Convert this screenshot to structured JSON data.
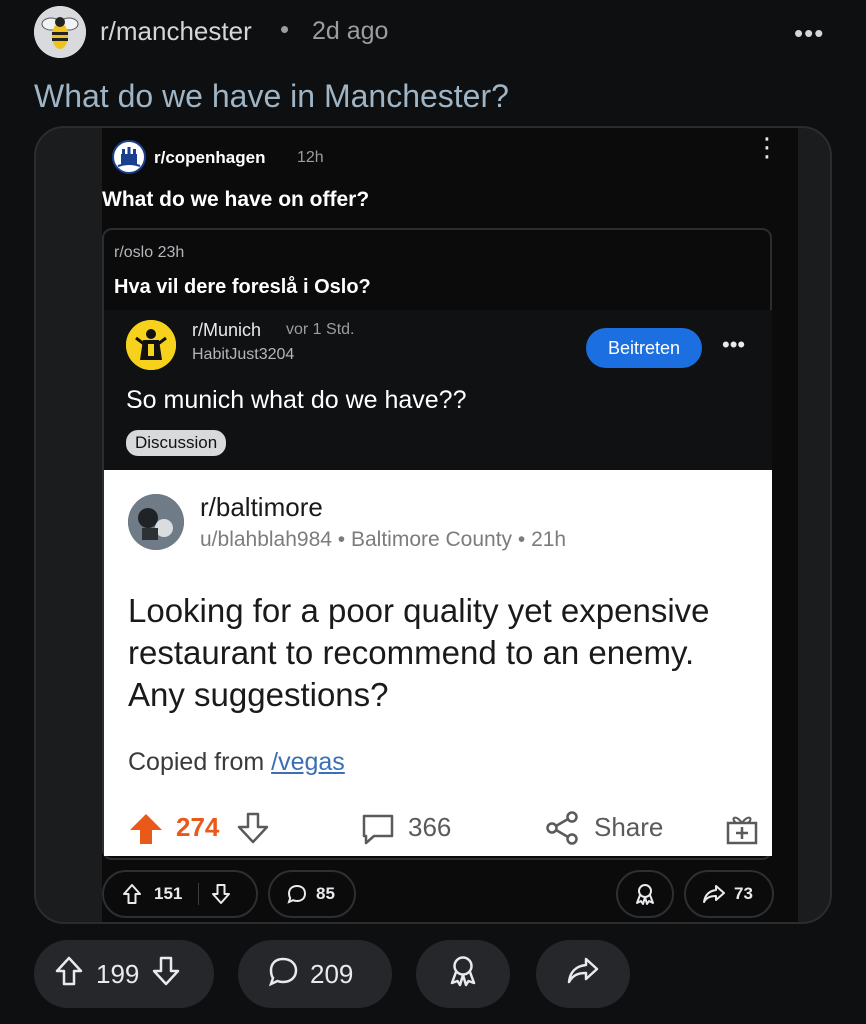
{
  "header": {
    "subreddit": "r/manchester",
    "separator": "•",
    "age": "2d ago",
    "overflow": "•••",
    "avatar_icon": "bee-icon"
  },
  "post": {
    "title": "What do we have in Manchester?"
  },
  "copenhagen": {
    "subreddit": "r/copenhagen",
    "age": "12h",
    "overflow": "⋮",
    "title": "What do we have on offer?",
    "icon": "copenhagen-crest-icon"
  },
  "oslo": {
    "subreddit": "r/oslo",
    "age": "23h",
    "title": "Hva vil dere foreslå i Oslo?"
  },
  "munich": {
    "subreddit": "r/Munich",
    "age": "vor 1 Std.",
    "user": "HabitJust3204",
    "join_label": "Beitreten",
    "overflow": "•••",
    "title": "So munich what do we have??",
    "flair": "Discussion",
    "icon": "munich-monk-icon",
    "join_color": "#1c6fe0"
  },
  "baltimore": {
    "subreddit": "r/baltimore",
    "meta": "u/blahblah984 • Baltimore County • 21h",
    "title": "Looking for a poor quality yet expensive restaurant to recommend to an enemy. Any suggestions?",
    "copied_prefix": "Copied from ",
    "copied_link": "/vegas",
    "score": "274",
    "comments": "366",
    "share_label": "Share",
    "accent_color": "#e8591a"
  },
  "inner_actions": {
    "votes": "151",
    "comments": "85",
    "shares": "73"
  },
  "bottom_actions": {
    "votes": "199",
    "comments": "209"
  }
}
